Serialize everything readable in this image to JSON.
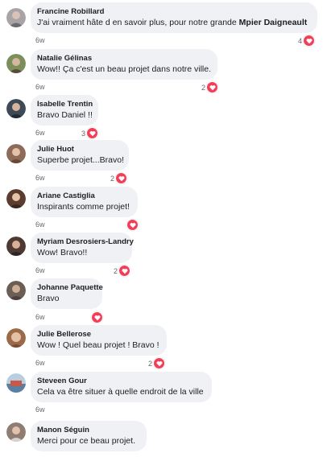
{
  "comments": [
    {
      "author": "Francine Robillard",
      "text": "J'ai vraiment hâte d en savoir plus, pour notre grande ",
      "mention": "Mpier Daigneault",
      "time": "6w",
      "reactions": "4",
      "avatar_color": "#a7a3a6"
    },
    {
      "author": "Natalie Gélinas",
      "text": "Wow!! Ça c'est un beau projet dans notre ville.",
      "time": "6w",
      "reactions": "2",
      "avatar_color": "#7a8f5a"
    },
    {
      "author": "Isabelle Trentin",
      "text": "Bravo Daniel !!",
      "time": "6w",
      "reactions": "3",
      "avatar_color": "#3f4a57"
    },
    {
      "author": "Julie Huot",
      "text": "Superbe projet...Bravo!",
      "time": "6w",
      "reactions": "2",
      "avatar_color": "#8e6a58"
    },
    {
      "author": "Ariane Castiglia",
      "text": "Inspirants comme projet!",
      "time": "6w",
      "reactions": "",
      "avatar_color": "#5a3d2e"
    },
    {
      "author": "Myriam Desrosiers-Landry",
      "text": "Wow! Bravo!!",
      "time": "6w",
      "reactions": "2",
      "avatar_color": "#4d3a33"
    },
    {
      "author": "Johanne Paquette",
      "text": "Bravo",
      "time": "6w",
      "reactions": "",
      "avatar_color": "#6b5e55"
    },
    {
      "author": "Julie Bellerose",
      "text": "Wow ! Quel beau projet ! Bravo !",
      "time": "6w",
      "reactions": "2",
      "avatar_color": "#9a6a4a"
    },
    {
      "author": "Steveen Gour",
      "text": "Cela va être situer à quelle endroit de la ville",
      "time": "6w",
      "reactions": null,
      "avatar_color": "#5b7fa0"
    },
    {
      "author": "Manon Séguin",
      "text": "Merci pour ce beau projet.",
      "time": null,
      "reactions": null,
      "avatar_color": "#8f7d74"
    }
  ]
}
